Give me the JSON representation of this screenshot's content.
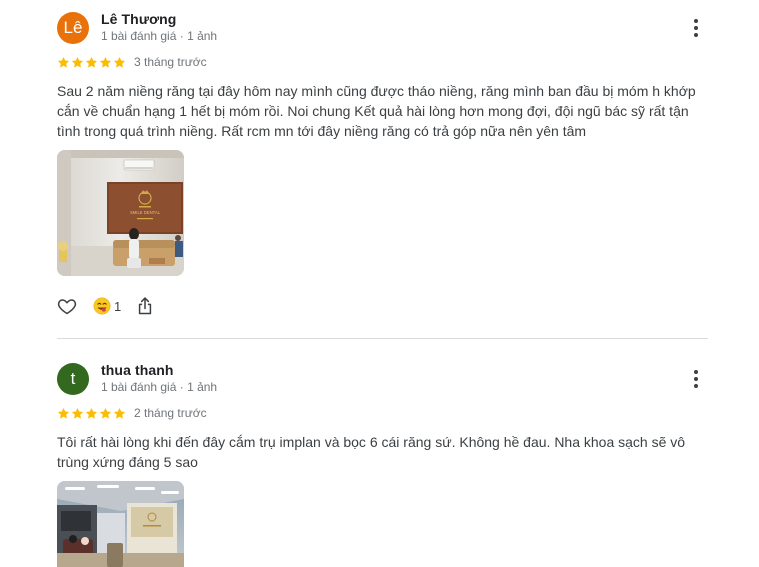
{
  "reviews": [
    {
      "avatar_text": "Lê",
      "avatar_color": "#e8710a",
      "name": "Lê Thương",
      "meta": "1 bài đánh giá · 1 ảnh",
      "stars": 5,
      "time": "3 tháng trước",
      "text": "Sau 2 năm niềng răng tại đây hôm nay mình cũng được tháo niềng, răng mình ban đầu bị móm h khớp cắn về chuẩn hạng 1 hết bị móm rồi. Noi chung Kết quả hài lòng hơn mong đợi, đội ngũ bác sỹ rất tận tình trong quá trình niềng. Rất rcm mn tới đây niềng răng có trả góp nữa nên yên tâm",
      "reaction_count": "1",
      "photo_icon": "clinic-reception-photo"
    },
    {
      "avatar_text": "t",
      "avatar_color": "#33691e",
      "name": "thua thanh",
      "meta": "1 bài đánh giá · 1 ảnh",
      "stars": 5,
      "time": "2 tháng trước",
      "text": "Tôi rất hài lòng khi đến đây cắm trụ implan và bọc 6 cái răng sứ. Không hề đau. Nha khoa sạch sẽ vô trùng xứng đáng 5 sao",
      "photo_icon": "clinic-interior-photo"
    }
  ],
  "photo1_sign_text": "SMILE DENTAL",
  "colors": {
    "star": "#fbbc04",
    "meta_text": "#70757a",
    "divider": "#dadce0"
  }
}
